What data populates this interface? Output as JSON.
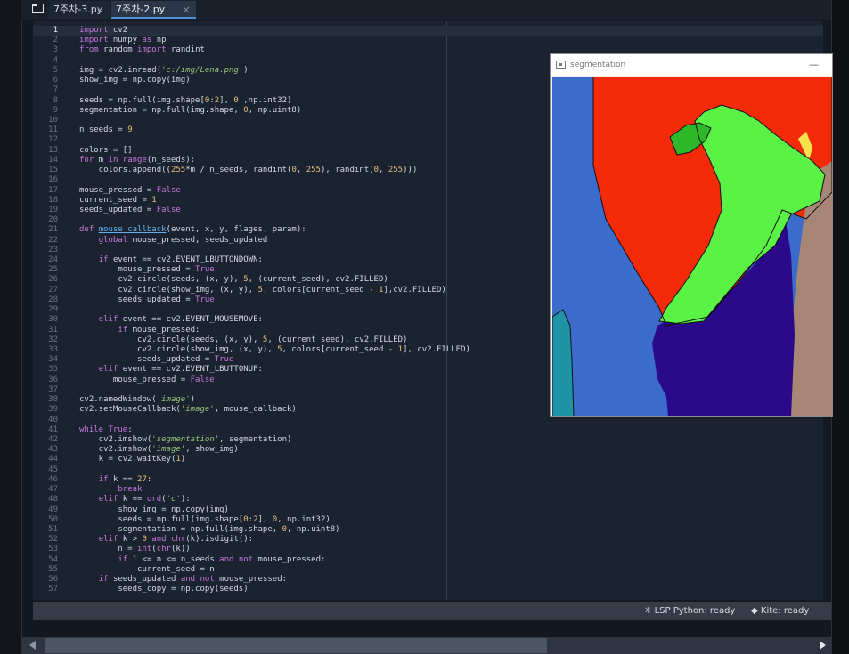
{
  "tabs": [
    {
      "label": "7주차-3.py",
      "close": "×"
    },
    {
      "label": "7주차-2.py",
      "close": "×"
    }
  ],
  "editor": {
    "lines": [
      {
        "n": "1",
        "html": "<span class=\"kw\">import</span> cv2"
      },
      {
        "n": "2",
        "html": "<span class=\"kw\">import</span> numpy <span class=\"kw\">as</span> np"
      },
      {
        "n": "3",
        "html": "<span class=\"kw\">from</span> random <span class=\"kw\">import</span> randint"
      },
      {
        "n": "4",
        "html": ""
      },
      {
        "n": "5",
        "html": "img = cv2.imread(<span class=\"str\">'c:/img/Lena.png'</span>)"
      },
      {
        "n": "6",
        "html": "show_img = np.copy(img)"
      },
      {
        "n": "7",
        "html": ""
      },
      {
        "n": "8",
        "html": "seeds = np.full(img.shape[<span class=\"num\">0</span>:<span class=\"num\">2</span>], <span class=\"num\">0</span> ,np.int32)"
      },
      {
        "n": "9",
        "html": "segmentation = np.full(img.shape, <span class=\"num\">0</span>, np.uint8)"
      },
      {
        "n": "10",
        "html": ""
      },
      {
        "n": "11",
        "html": "n_seeds = <span class=\"num\">9</span>"
      },
      {
        "n": "12",
        "html": ""
      },
      {
        "n": "13",
        "html": "colors = []"
      },
      {
        "n": "14",
        "html": "<span class=\"kw\">for</span> m <span class=\"kw\">in</span> <span class=\"kw\">range</span>(n_seeds):"
      },
      {
        "n": "15",
        "html": "    colors.append((<span class=\"num\">255</span>*m / n_seeds, randint(<span class=\"num\">0</span>, <span class=\"num\">255</span>), randint(<span class=\"num\">0</span>, <span class=\"num\">255</span>)))"
      },
      {
        "n": "16",
        "html": ""
      },
      {
        "n": "17",
        "html": "mouse_pressed = <span class=\"kw\">False</span>"
      },
      {
        "n": "18",
        "html": "current_seed = <span class=\"num\">1</span>"
      },
      {
        "n": "19",
        "html": "seeds_updated = <span class=\"kw\">False</span>"
      },
      {
        "n": "20",
        "html": ""
      },
      {
        "n": "21",
        "html": "<span class=\"kw\">def</span> <span class=\"fn\">mouse_callback</span>(event, x, y, flages, param):"
      },
      {
        "n": "22",
        "html": "    <span class=\"kw\">global</span> mouse_pressed, seeds_updated"
      },
      {
        "n": "23",
        "html": ""
      },
      {
        "n": "24",
        "html": "    <span class=\"kw\">if</span> event == cv2.EVENT_LBUTTONDOWN:"
      },
      {
        "n": "25",
        "html": "        mouse_pressed = <span class=\"kw\">True</span>"
      },
      {
        "n": "26",
        "html": "        cv2.circle(seeds, (x, y), <span class=\"num\">5</span>, (current_seed), cv2.FILLED)"
      },
      {
        "n": "27",
        "html": "        cv2.circle(show_img, (x, y), <span class=\"num\">5</span>, colors[current_seed - <span class=\"num\">1</span>],cv2.FILLED)"
      },
      {
        "n": "28",
        "html": "        seeds_updated = <span class=\"kw\">True</span>"
      },
      {
        "n": "29",
        "html": ""
      },
      {
        "n": "30",
        "html": "    <span class=\"kw\">elif</span> event == cv2.EVENT_MOUSEMOVE:"
      },
      {
        "n": "31",
        "html": "        <span class=\"kw\">if</span> mouse_pressed:"
      },
      {
        "n": "32",
        "html": "            cv2.circle(seeds, (x, y), <span class=\"num\">5</span>, (current_seed), cv2.FILLED)"
      },
      {
        "n": "33",
        "html": "            cv2.circle(show_img, (x, y), <span class=\"num\">5</span>, colors[current_seed - <span class=\"num\">1</span>], cv2.FILLED)"
      },
      {
        "n": "34",
        "html": "            seeds_updated = <span class=\"kw\">True</span>"
      },
      {
        "n": "35",
        "html": "    <span class=\"kw\">elif</span> event == cv2.EVENT_LBUTTONUP:"
      },
      {
        "n": "36",
        "html": "       mouse_pressed = <span class=\"kw\">False</span>"
      },
      {
        "n": "37",
        "html": ""
      },
      {
        "n": "38",
        "html": "cv2.namedWindow(<span class=\"str\">'image'</span>)"
      },
      {
        "n": "39",
        "html": "cv2.setMouseCallback(<span class=\"str\">'image'</span>, mouse_callback)"
      },
      {
        "n": "40",
        "html": ""
      },
      {
        "n": "41",
        "html": "<span class=\"kw\">while</span> <span class=\"kw\">True</span>:"
      },
      {
        "n": "42",
        "html": "    cv2.imshow(<span class=\"str\">'segmentation'</span>, segmentation)"
      },
      {
        "n": "43",
        "html": "    cv2.imshow(<span class=\"str\">'image'</span>, show_img)"
      },
      {
        "n": "44",
        "html": "    k = cv2.waitKey(<span class=\"num\">1</span>)"
      },
      {
        "n": "45",
        "html": ""
      },
      {
        "n": "46",
        "html": "    <span class=\"kw\">if</span> k == <span class=\"num\">27</span>:"
      },
      {
        "n": "47",
        "html": "        <span class=\"kw\">break</span>"
      },
      {
        "n": "48",
        "html": "    <span class=\"kw\">elif</span> k == <span class=\"kw\">ord</span>(<span class=\"str\">'c'</span>):"
      },
      {
        "n": "49",
        "html": "        show_img = np.copy(img)"
      },
      {
        "n": "50",
        "html": "        seeds = np.full(img.shape[<span class=\"num\">0</span>:<span class=\"num\">2</span>], <span class=\"num\">0</span>, np.int32)"
      },
      {
        "n": "51",
        "html": "        segmentation = np.full(img.shape, <span class=\"num\">0</span>, np.uint8)"
      },
      {
        "n": "52",
        "html": "    <span class=\"kw\">elif</span> k &gt; <span class=\"num\">0</span> <span class=\"kw\">and</span> <span class=\"kw\">chr</span>(k).isdigit():"
      },
      {
        "n": "53",
        "html": "        n = <span class=\"kw\">int</span>(<span class=\"kw\">chr</span>(k))"
      },
      {
        "n": "54",
        "html": "        <span class=\"kw\">if</span> <span class=\"num\">1</span> &lt;= n &lt;= n_seeds <span class=\"kw\">and</span> <span class=\"kw\">not</span> mouse_pressed:"
      },
      {
        "n": "55",
        "html": "            current_seed = n"
      },
      {
        "n": "56",
        "html": "    <span class=\"kw\">if</span> seeds_updated <span class=\"kw\">and</span> <span class=\"kw\">not</span> mouse_pressed:"
      },
      {
        "n": "57",
        "html": "        seeds_copy = np.copy(seeds)"
      }
    ]
  },
  "statusbar": {
    "lsp": "LSP Python: ready",
    "kite": "Kite: ready"
  },
  "segmentation_window": {
    "title": "segmentation",
    "minimize": "—",
    "colors": {
      "blue": "#3c6ccb",
      "red": "#f52a08",
      "green": "#5af244",
      "dark_green": "#2db82a",
      "yellow": "#f5e34c",
      "indigo": "#2a0a8a",
      "teal": "#1f93a6",
      "brown": "#a78676"
    }
  }
}
